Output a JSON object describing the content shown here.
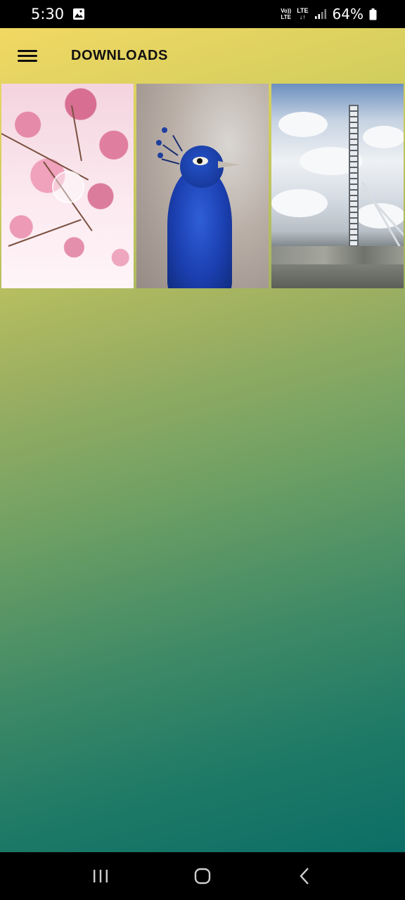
{
  "status_bar": {
    "time": "5:30",
    "volte_top": "Vo))",
    "volte_bottom": "LTE",
    "lte_top": "LTE",
    "lte_bottom": "↓↑",
    "battery": "64%"
  },
  "app_bar": {
    "title": "DOWNLOADS"
  },
  "downloads": [
    {
      "subject": "cherry-blossom",
      "has_play_overlay": true
    },
    {
      "subject": "peacock",
      "has_play_overlay": false
    },
    {
      "subject": "london-eye",
      "has_play_overlay": false
    }
  ],
  "colors": {
    "gradient_top": "#f2d863",
    "gradient_bottom": "#0b6e66",
    "system_bars": "#000000"
  },
  "nav_bar": {
    "icons": [
      "recents-icon",
      "home-icon",
      "back-icon"
    ]
  }
}
